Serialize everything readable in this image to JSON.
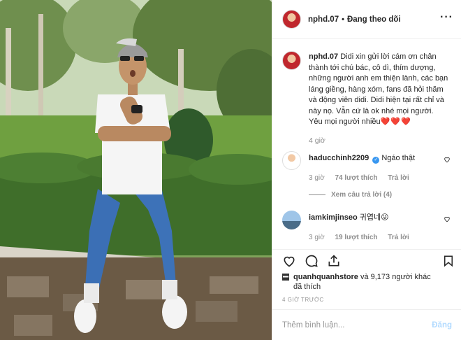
{
  "header": {
    "username": "nphd.07",
    "separator": "•",
    "follow_status": "Đang theo dõi",
    "more": "···"
  },
  "caption": {
    "username": "nphd.07",
    "text": "Didi xin gửi lời cám ơn chân thành tới chú bác, cô dì, thím dượng, những người anh em thiện lành, các bạn láng giềng, hàng xóm, fans đã hỏi thăm và động viên didi. Didi hiện tại rất chỉ và này nọ. Vẫn cứ là ok nhé mọi người.",
    "line2": "Yêu mọi người nhiều",
    "hearts": "❤️❤️❤️",
    "time": "4 giờ"
  },
  "comments": [
    {
      "username": "haducchinh2209",
      "verified": true,
      "text": "Ngáo thật",
      "time": "3 giờ",
      "likes": "74 lượt thích",
      "reply": "Trả lời",
      "view_replies": "Xem câu trả lời (4)"
    },
    {
      "username": "iamkimjinseo",
      "verified": false,
      "text": "귀엽네😜",
      "time": "3 giờ",
      "likes": "19 lượt thích",
      "reply": "Trả lời"
    }
  ],
  "likes": {
    "first_user": "quanhquanhstore",
    "rest": " và 9,173 người khác",
    "line2": "đã thích"
  },
  "post_time": "4 GIỜ TRƯỚC",
  "add_comment": {
    "placeholder": "Thêm bình luận...",
    "post_label": "Đăng"
  },
  "icons": [
    "heart-icon",
    "comment-icon",
    "share-icon",
    "bookmark-icon"
  ],
  "colors": {
    "link_blue": "#3897f0",
    "heart_red": "#e0292b",
    "muted": "#8e8e8e",
    "post_disabled": "#b3dbff"
  }
}
